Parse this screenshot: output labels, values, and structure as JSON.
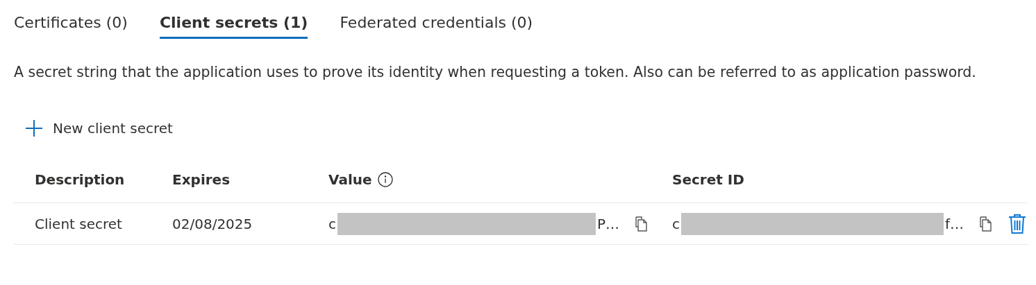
{
  "tabs": [
    {
      "label": "Certificates (0)",
      "selected": false
    },
    {
      "label": "Client secrets (1)",
      "selected": true
    },
    {
      "label": "Federated credentials (0)",
      "selected": false
    }
  ],
  "description": "A secret string that the application uses to prove its identity when requesting a token. Also can be referred to as application password.",
  "toolbar": {
    "new_button": "New client secret"
  },
  "table": {
    "columns": [
      {
        "label": "Description",
        "info": false
      },
      {
        "label": "Expires",
        "info": false
      },
      {
        "label": "Value",
        "info": true
      },
      {
        "label": "Secret ID",
        "info": false
      }
    ],
    "rows": [
      {
        "description": "Client secret",
        "expires": "02/08/2025",
        "value": {
          "start": "c",
          "end": "P…",
          "redacted": true
        },
        "secret_id": {
          "start": "c",
          "end": "f…",
          "redacted": true
        }
      }
    ]
  }
}
